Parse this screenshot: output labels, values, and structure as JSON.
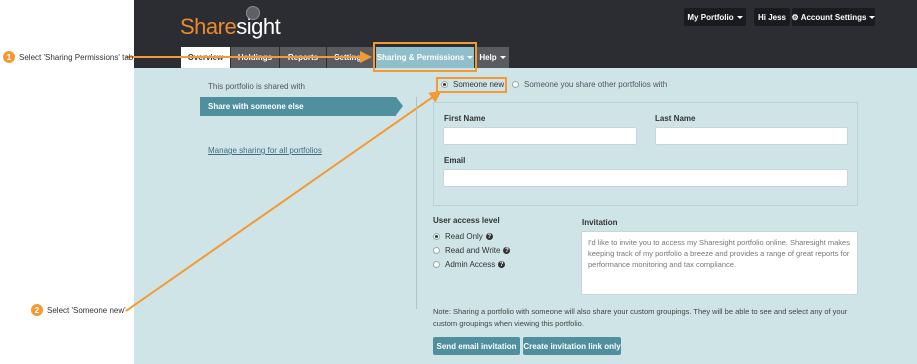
{
  "annotations": {
    "step1_num": "1",
    "step1_text": "Select 'Sharing Permissions' tab",
    "step2_num": "2",
    "step2_text": "Select 'Someone new'",
    "accent_color": "#f39a34"
  },
  "header": {
    "logo_share": "Share",
    "logo_sight": "sight",
    "my_portfolio": "My Portfolio",
    "user_greeting": "Hi Jess",
    "account_settings": "Account Settings"
  },
  "tabs": [
    {
      "label": "Overview"
    },
    {
      "label": "Holdings"
    },
    {
      "label": "Reports"
    },
    {
      "label": "Settings"
    },
    {
      "label": "Sharing & Permissions"
    },
    {
      "label": "Help"
    }
  ],
  "sidebar": {
    "shared_with": "This portfolio is shared with",
    "active_item": "Share with someone else",
    "manage_link": "Manage sharing for all portfolios"
  },
  "share_options": {
    "someone_new": "Someone new",
    "someone_other": "Someone you share other portfolios with"
  },
  "form": {
    "first_name_label": "First Name",
    "last_name_label": "Last Name",
    "email_label": "Email",
    "first_name_value": "",
    "last_name_value": "",
    "email_value": ""
  },
  "access": {
    "title": "User access level",
    "options": [
      "Read Only",
      "Read and Write",
      "Admin Access"
    ],
    "selected": "Read Only"
  },
  "invitation": {
    "title": "Invitation",
    "text": "I'd like to invite you to access my Sharesight portfolio online. Sharesight makes keeping track of my portfolio a breeze and provides a range of great reports for performance monitoring and tax compliance."
  },
  "note": "Note: Sharing a portfolio with someone will also share your custom groupings. They will be able to see and select any of your custom groupings when viewing this portfolio.",
  "buttons": {
    "send_email": "Send email invitation",
    "create_link": "Create invitation link only"
  },
  "colors": {
    "header_bg": "#2c2d33",
    "content_bg": "#cfe4e7",
    "teal": "#4f8f9e",
    "brand_orange": "#e98b2c"
  }
}
